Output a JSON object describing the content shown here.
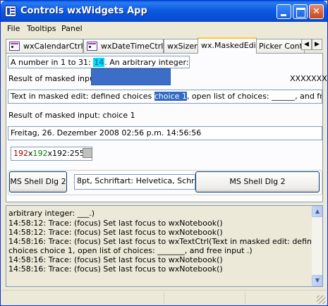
{
  "window": {
    "title": "Controls wxWidgets App"
  },
  "menu": {
    "file": "File",
    "tooltips": "Tooltips",
    "panel": "Panel"
  },
  "tabs": [
    {
      "label": "wxCalendarCtrl"
    },
    {
      "label": "wxDateTimeCtrl"
    },
    {
      "label": "wxSizer"
    },
    {
      "label": "wx.MaskedEdit"
    },
    {
      "label": "Picker Contro"
    }
  ],
  "tab_scroll": {
    "left": "◀",
    "right": "▶"
  },
  "masked": {
    "line1_prefix": "A number in 1 to 31: ",
    "line1_number": "14",
    "line1_middle": ". An arbitrary integer: ",
    "line1_suffix": ".",
    "result_label": "Result of masked input:",
    "result_mask": "XXXXXXX",
    "line2_before": "Text in masked edit: defined choices ",
    "line2_selected": "choice 1",
    "line2_after": ", open list of choices: ______, and free input",
    "result2": "Result of masked input: choice 1",
    "datetime": "Freitag, 26. Dezember 2008 02:56 p.m. 14:56:56",
    "color_r": "192",
    "color_x1": "x",
    "color_g": "192",
    "color_x2": "x192:255"
  },
  "font": {
    "button1": "MS Shell Dlg 2",
    "desc": "8pt, Schriftart:     Helvetica, Schri",
    "button2": "MS Shell Dlg 2"
  },
  "log": [
    "arbitrary integer: ___.)",
    "14:58:12: Trace: (focus) Set last focus to wxNotebook()",
    "14:58:12: Trace: (focus) Set last focus to wxNotebook()",
    "14:58:16: Trace: (focus) Set last focus to wxTextCtrl(Text in masked edit: defined",
    "choices choice 1, open list of choices: _______, and free input      .)",
    "14:58:16: Trace: (focus) Set last focus to wxNotebook()",
    "14:58:16: Trace: (focus) Set last focus to wxNotebook()"
  ],
  "scroll": {
    "up": "▲",
    "down": "▼"
  }
}
